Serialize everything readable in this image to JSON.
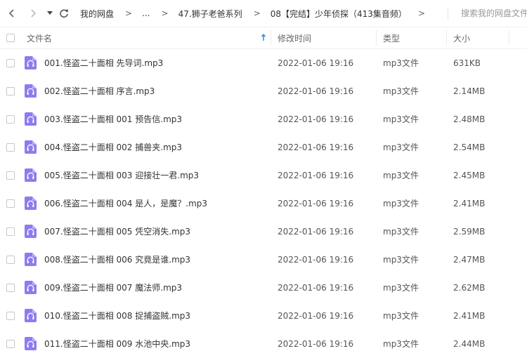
{
  "nav": {
    "breadcrumbs": [
      "我的网盘",
      "...",
      "47.狮子老爸系列",
      "08【完结】少年侦探（413集音频）"
    ],
    "separator": ">",
    "search_placeholder": "搜索我的网盘文件"
  },
  "table": {
    "columns": {
      "name": "文件名",
      "modified": "修改时间",
      "type": "类型",
      "size": "大小"
    },
    "sort": "name-ascending",
    "rows": [
      {
        "name": "001.怪盗二十面相 先导词.mp3",
        "modified": "2022-01-06 19:16",
        "type": "mp3文件",
        "size": "631KB"
      },
      {
        "name": "002.怪盗二十面相 序言.mp3",
        "modified": "2022-01-06 19:16",
        "type": "mp3文件",
        "size": "2.14MB"
      },
      {
        "name": "003.怪盗二十面相 001 预告信.mp3",
        "modified": "2022-01-06 19:16",
        "type": "mp3文件",
        "size": "2.48MB"
      },
      {
        "name": "004.怪盗二十面相 002 捕兽夹.mp3",
        "modified": "2022-01-06 19:16",
        "type": "mp3文件",
        "size": "2.54MB"
      },
      {
        "name": "005.怪盗二十面相 003 迎接壮一君.mp3",
        "modified": "2022-01-06 19:16",
        "type": "mp3文件",
        "size": "2.45MB"
      },
      {
        "name": "006.怪盗二十面相 004 是人，是魔？.mp3",
        "modified": "2022-01-06 19:16",
        "type": "mp3文件",
        "size": "2.41MB"
      },
      {
        "name": "007.怪盗二十面相 005 凭空消失.mp3",
        "modified": "2022-01-06 19:16",
        "type": "mp3文件",
        "size": "2.59MB"
      },
      {
        "name": "008.怪盗二十面相 006 究竟是谁.mp3",
        "modified": "2022-01-06 19:16",
        "type": "mp3文件",
        "size": "2.47MB"
      },
      {
        "name": "009.怪盗二十面相 007 魔法师.mp3",
        "modified": "2022-01-06 19:16",
        "type": "mp3文件",
        "size": "2.62MB"
      },
      {
        "name": "010.怪盗二十面相 008 捉捕盗贼.mp3",
        "modified": "2022-01-06 19:16",
        "type": "mp3文件",
        "size": "2.41MB"
      },
      {
        "name": "011.怪盗二十面相 009 水池中央.mp3",
        "modified": "2022-01-06 19:16",
        "type": "mp3文件",
        "size": "2.44MB"
      }
    ]
  },
  "icons": {
    "back": "chevron-left-icon",
    "forward": "chevron-right-icon",
    "history": "caret-down-icon",
    "refresh": "refresh-icon",
    "sort": "arrow-up-icon",
    "file": "audio-file-icon"
  },
  "colors": {
    "file_icon": "#8c7cf0",
    "sort_arrow": "#3b8cff",
    "nav_icon": "#666666",
    "nav_icon_disabled": "#bbbbbb"
  }
}
